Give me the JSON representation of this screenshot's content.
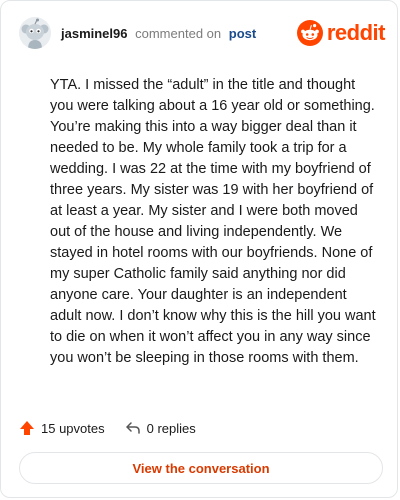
{
  "header": {
    "username": "jasminel96",
    "action_text": "commented on",
    "link_text": "post",
    "brand": "reddit"
  },
  "comment": {
    "text": "YTA. I missed the “adult” in the title and thought you were talking about a 16 year old or something. You’re making this into a way bigger deal than it needed to be. My whole family took a trip for a wedding. I was 22 at the time with my boyfriend of three years. My sister was 19 with her boyfriend of at least a year. My sister and I were both moved out of the house and living independently. We stayed in hotel rooms with our boyfriends. None of my super Catholic family said anything nor did anyone care. Your daughter is an independent adult now. I don’t know why this is the hill you want to die on when it won’t affect you in any way since you won’t be sleeping in those rooms with them."
  },
  "footer": {
    "upvotes_label": "15 upvotes",
    "replies_label": "0 replies",
    "upvote_icon": "upvote-arrow-icon",
    "reply_icon": "reply-arrow-icon"
  },
  "cta": {
    "label": "View the conversation"
  },
  "colors": {
    "brand_orange": "#ff4500",
    "cta_text": "#d93a00",
    "link_blue": "#1a4b8c",
    "border": "#e3e6e8"
  }
}
